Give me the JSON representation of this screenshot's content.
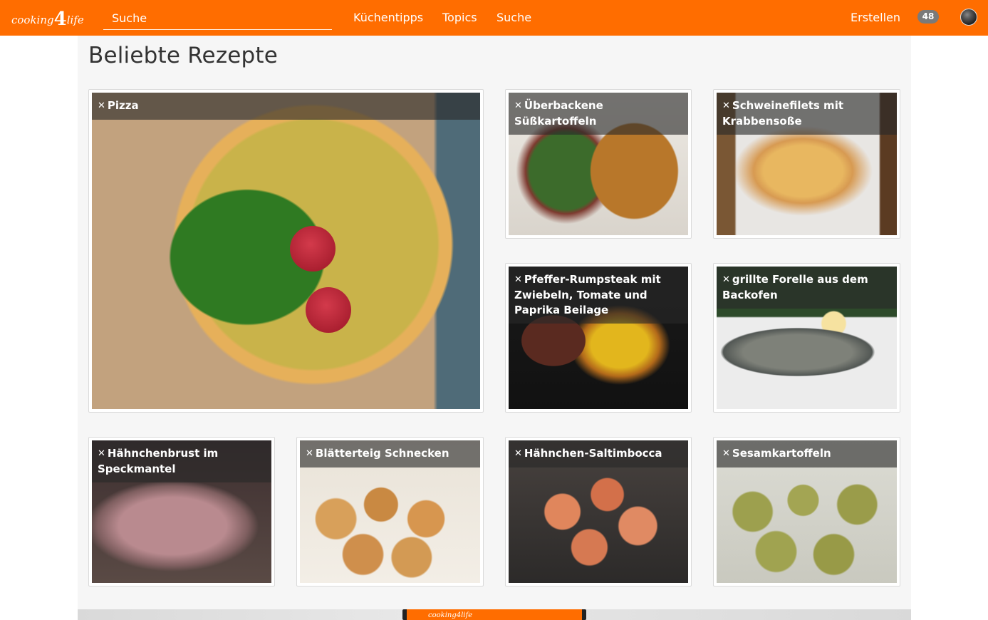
{
  "header": {
    "logo_text": "cooking",
    "logo_digit": "4",
    "logo_text2": "life",
    "search_placeholder": "Suche",
    "nav": [
      "Küchentipps",
      "Topics",
      "Suche"
    ],
    "create_label": "Erstellen",
    "notification_count": "48"
  },
  "colors": {
    "brand": "#ff6d00",
    "content_bg": "#f6f6f6"
  },
  "main": {
    "title": "Beliebte Rezepte",
    "recipes": [
      {
        "title": "Pizza",
        "icon": "fork-knife-icon"
      },
      {
        "title": "Überbackene Süßkartoffeln",
        "icon": "fork-knife-icon"
      },
      {
        "title": "Schweinefilets mit Krabbensoße",
        "icon": "fork-knife-icon"
      },
      {
        "title": "Pfeffer-Rumpsteak mit Zwiebeln, Tomate und Paprika Beilage",
        "icon": "fork-knife-icon"
      },
      {
        "title": "grillte Forelle aus dem Backofen",
        "icon": "fork-knife-icon"
      },
      {
        "title": "Hähnchenbrust im Speckmantel",
        "icon": "fork-knife-icon"
      },
      {
        "title": "Blätterteig Schnecken",
        "icon": "fork-knife-icon"
      },
      {
        "title": "Hähnchen-Saltimbocca",
        "icon": "fork-knife-icon"
      },
      {
        "title": "Sesamkartoffeln",
        "icon": "fork-knife-icon"
      }
    ]
  },
  "banner": {
    "app_text": "cooking4life"
  }
}
